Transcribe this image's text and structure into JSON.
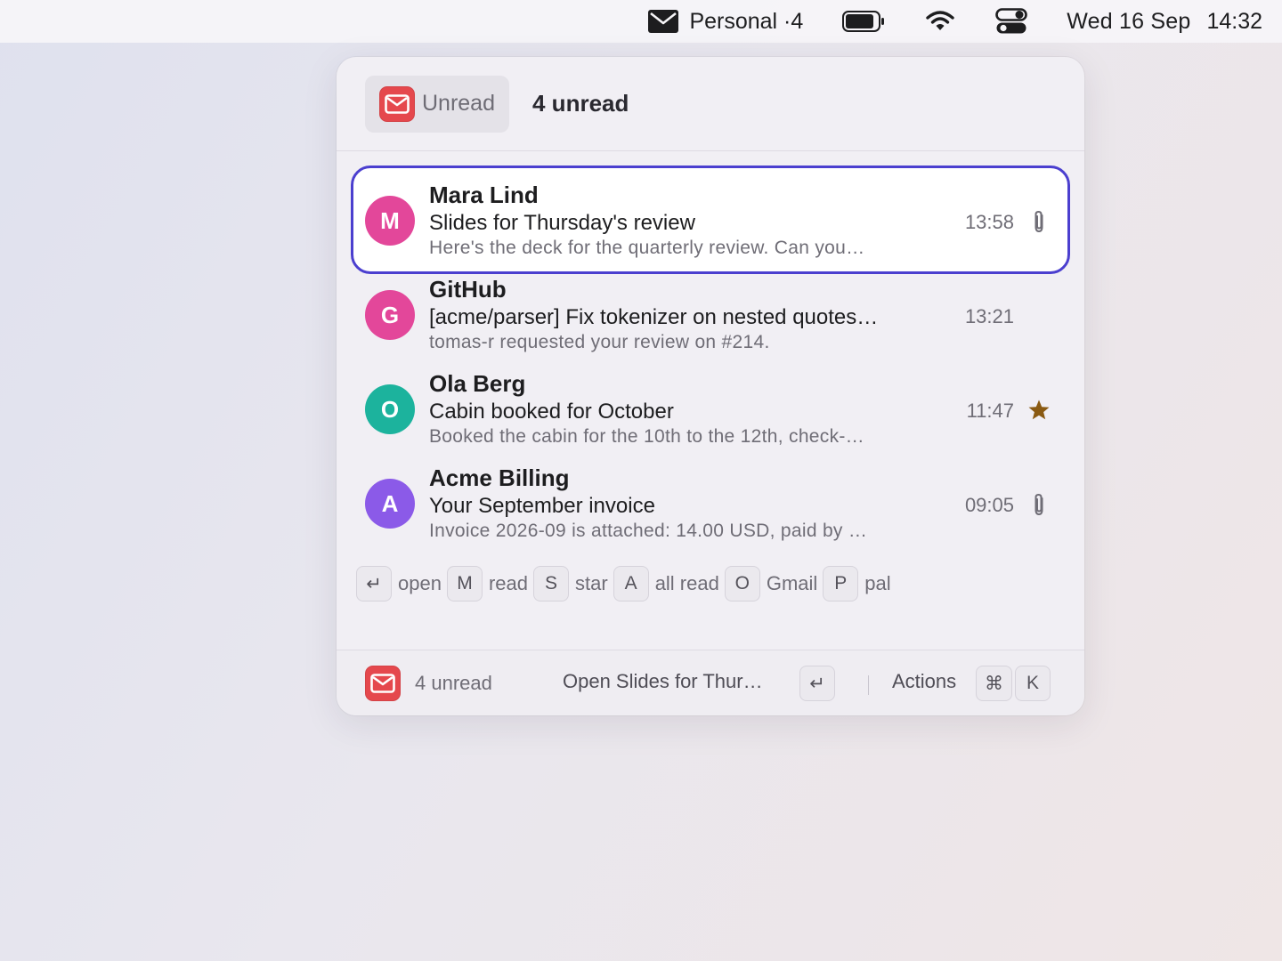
{
  "menubar": {
    "mail_label": "Personal ·4",
    "date": "Wed 16 Sep",
    "time": "14:32",
    "icons": [
      "envelope-icon",
      "battery-icon",
      "wifi-icon",
      "control-center-icon"
    ]
  },
  "panel": {
    "mode_label": "Unread",
    "title": "4 unread",
    "accent_color": "#4b3fcf",
    "app_color": "#e5484d"
  },
  "messages": [
    {
      "initial": "M",
      "avatar_color": "#e3479a",
      "sender": "Mara Lind",
      "subject": "Slides for Thursday's review",
      "preview": "Here's the deck for the quarterly review. Can you…",
      "time": "13:58",
      "icon": "paperclip-icon",
      "selected": true
    },
    {
      "initial": "G",
      "avatar_color": "#e3479a",
      "sender": "GitHub",
      "subject": "[acme/parser] Fix tokenizer on nested quotes…",
      "preview": "tomas-r requested your review on #214.",
      "time": "13:21",
      "icon": "",
      "selected": false
    },
    {
      "initial": "O",
      "avatar_color": "#1cb39d",
      "sender": "Ola Berg",
      "subject": "Cabin booked for October",
      "preview": "Booked the cabin for the 10th to the 12th, check-…",
      "time": "11:47",
      "icon": "star-icon",
      "selected": false
    },
    {
      "initial": "A",
      "avatar_color": "#8b5ae8",
      "sender": "Acme Billing",
      "subject": "Your September invoice",
      "preview": "Invoice 2026-09 is attached: 14.00 USD, paid by …",
      "time": "09:05",
      "icon": "paperclip-icon",
      "selected": false
    }
  ],
  "hints": [
    {
      "key": "↵",
      "label": "open"
    },
    {
      "key": "M",
      "label": "read"
    },
    {
      "key": "S",
      "label": "star"
    },
    {
      "key": "A",
      "label": "all read"
    },
    {
      "key": "O",
      "label": "Gmail"
    },
    {
      "key": "P",
      "label": "pal"
    }
  ],
  "footer": {
    "count": "4 unread",
    "primary_action": "Open Slides for Thur…",
    "enter_key": "↵",
    "actions_label": "Actions",
    "cmd_key": "⌘",
    "k_key": "K"
  }
}
